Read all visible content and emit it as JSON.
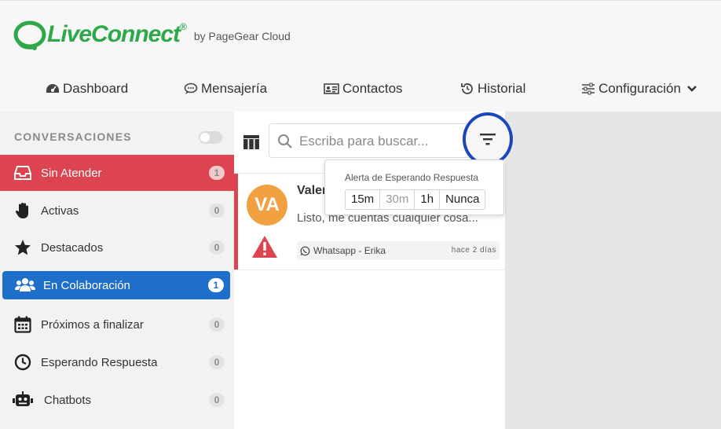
{
  "brand": {
    "name": "LiveConnect",
    "reg": "®",
    "by": "by PageGear Cloud"
  },
  "nav": {
    "dashboard": "Dashboard",
    "messaging": "Mensajería",
    "contacts": "Contactos",
    "history": "Historial",
    "settings": "Configuración"
  },
  "sidebar": {
    "title": "CONVERSACIONES",
    "items": [
      {
        "label": "Sin Atender",
        "count": "1"
      },
      {
        "label": "Activas",
        "count": "0"
      },
      {
        "label": "Destacados",
        "count": "0"
      },
      {
        "label": "En Colaboración",
        "count": "1"
      },
      {
        "label": "Próximos a finalizar",
        "count": "0"
      },
      {
        "label": "Esperando Respuesta",
        "count": "0"
      },
      {
        "label": "Chatbots",
        "count": "0"
      }
    ]
  },
  "search": {
    "placeholder": "Escriba para buscar..."
  },
  "conversation": {
    "initials": "VA",
    "name": "Valer",
    "message": "Listo, me cuentas cualquier cosa...",
    "channel": "Whatsapp - Erika",
    "time": "hace 2 días"
  },
  "popover": {
    "title": "Alerta de Esperando Respuesta",
    "options": [
      "15m",
      "30m",
      "1h",
      "Nunca"
    ]
  },
  "colors": {
    "accent_red": "#dc4550",
    "accent_blue": "#1d6fc9",
    "brand_green": "#2ea84a",
    "highlight_ring": "#1c45c0"
  }
}
